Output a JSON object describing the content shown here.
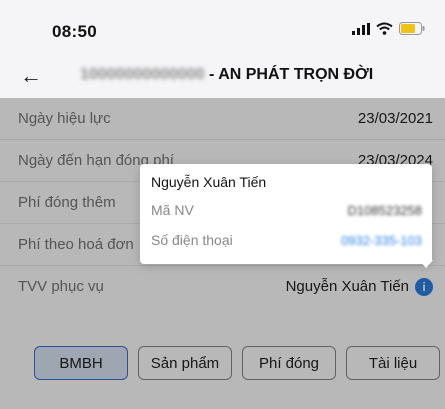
{
  "status_bar": {
    "time": "08:50"
  },
  "nav": {
    "back_glyph": "←",
    "policy_number": "10000000000000",
    "title_suffix": " - AN PHÁT TRỌN ĐỜI"
  },
  "details": [
    {
      "label": "Ngày hiệu lực",
      "value": "23/03/2021"
    },
    {
      "label": "Ngày đến hạn đóng phí",
      "value": "23/03/2024"
    },
    {
      "label": "Phí đóng thêm",
      "value": ""
    },
    {
      "label": "Phí theo hoá đơn",
      "value": ""
    },
    {
      "label": "TVV phục vụ",
      "value": "Nguyễn Xuân Tiến"
    }
  ],
  "popover": {
    "name": "Nguyễn Xuân Tiến",
    "employee_label": "Mã NV",
    "employee_value": "D108523258",
    "phone_label": "Số điện thoại",
    "phone_value": "0932-335-103"
  },
  "tabs": [
    "BMBH",
    "Sản phẩm",
    "Phí đóng",
    "Tài liệu"
  ],
  "colors": {
    "accent": "#2a82e4",
    "active_tab_bg": "#dce6f7",
    "battery": "#f2c21b"
  },
  "icons": [
    "signal-icon",
    "wifi-icon",
    "battery-icon",
    "back-arrow-icon",
    "info-icon"
  ]
}
